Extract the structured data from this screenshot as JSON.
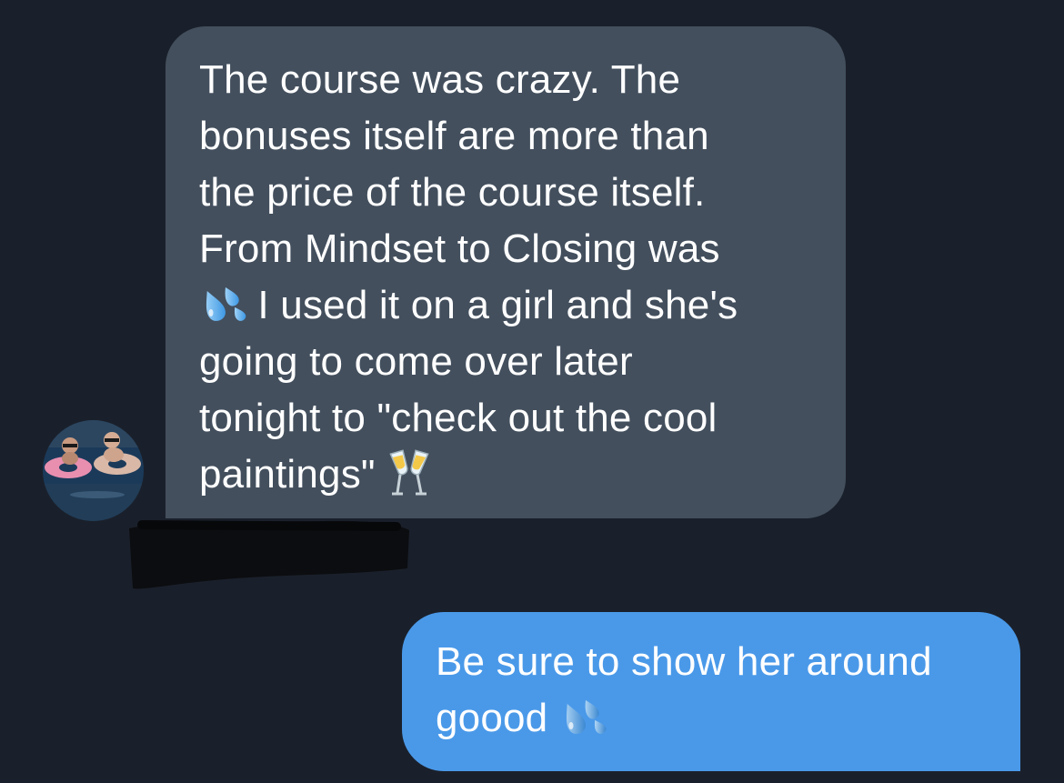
{
  "conversation": {
    "incoming": {
      "avatar_icon": "user-avatar-pool-photo",
      "lines": [
        "The course was crazy. The",
        "bonuses itself are more than",
        "the price of the course itself.",
        "From Mindset to Closing was",
        " I used it on a girl and she's",
        "going to come over later",
        "tonight to \"check out the cool",
        "paintings\" "
      ],
      "emojis": [
        "sweat-droplets-emoji",
        "clinking-glasses-emoji"
      ]
    },
    "outgoing": {
      "lines": [
        "Be sure to show her around",
        "goood "
      ],
      "emojis": [
        "sweat-droplets-emoji"
      ]
    }
  },
  "colors": {
    "background": "#1a202b",
    "incoming_bubble": "#434f5d",
    "outgoing_bubble": "#4a99e9",
    "text": "#ffffff"
  }
}
